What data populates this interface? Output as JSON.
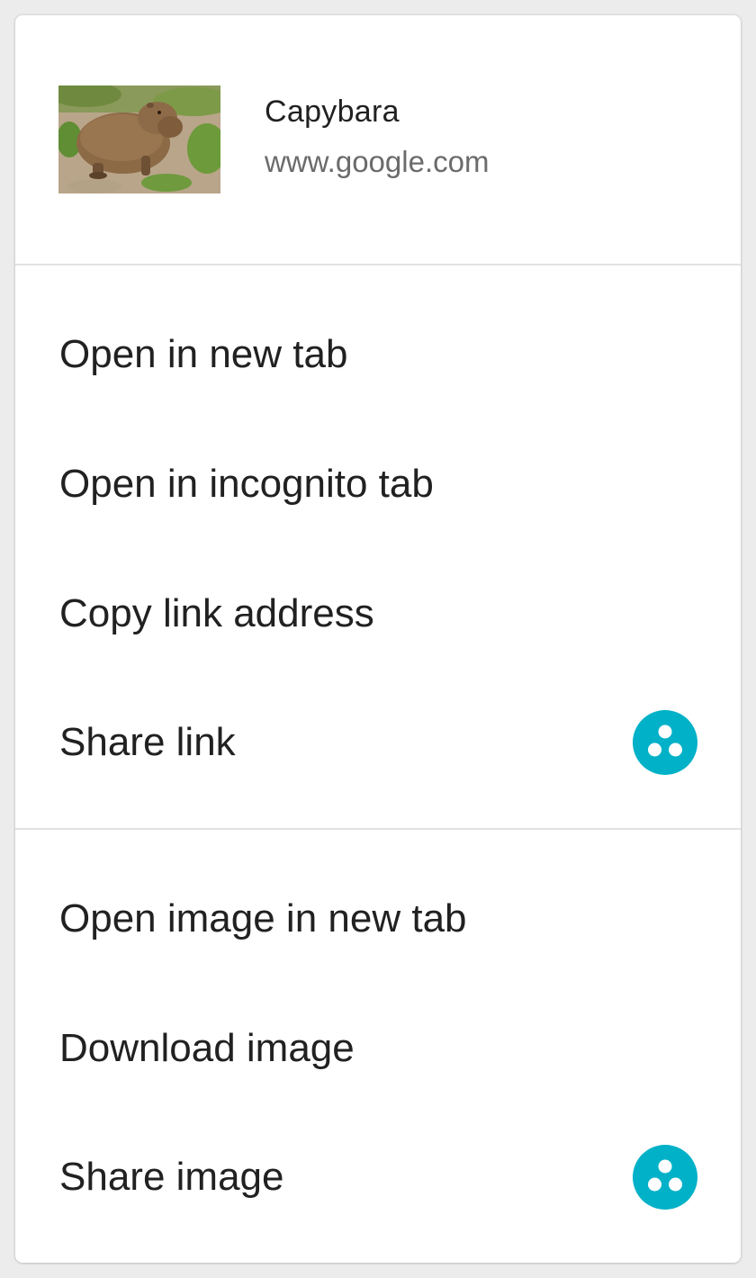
{
  "header": {
    "title": "Capybara",
    "url": "www.google.com",
    "thumbnail_subject": "capybara-photo"
  },
  "link_section": {
    "items": [
      {
        "label": "Open in new tab"
      },
      {
        "label": "Open in incognito tab"
      },
      {
        "label": "Copy link address"
      },
      {
        "label": "Share link",
        "icon": "share-app-icon"
      }
    ]
  },
  "image_section": {
    "items": [
      {
        "label": "Open image in new tab"
      },
      {
        "label": "Download image"
      },
      {
        "label": "Share image",
        "icon": "share-app-icon"
      }
    ]
  },
  "colors": {
    "share_icon": "#00b1c8",
    "text_primary": "#212121",
    "text_secondary": "#6b6b6b",
    "divider": "#e2e2e2"
  }
}
